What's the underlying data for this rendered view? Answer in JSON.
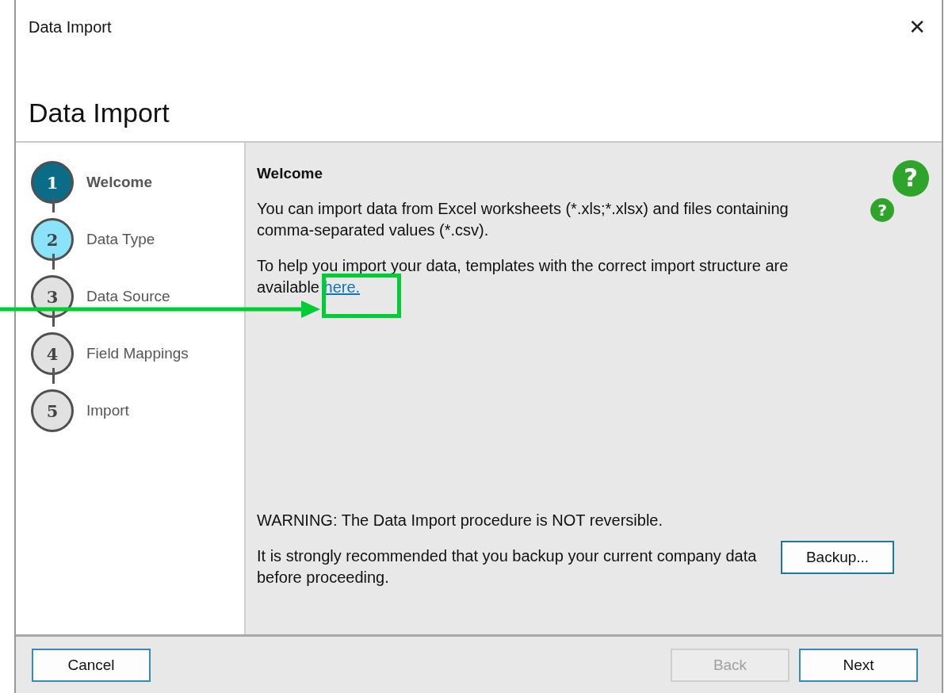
{
  "window": {
    "title": "Data Import",
    "close": "✕"
  },
  "header": {
    "title": "Data Import"
  },
  "steps": [
    {
      "number": "1",
      "label": "Welcome",
      "kind": "current"
    },
    {
      "number": "2",
      "label": "Data Type",
      "kind": "next"
    },
    {
      "number": "3",
      "label": "Data Source",
      "kind": "pending"
    },
    {
      "number": "4",
      "label": "Field Mappings",
      "kind": "pending"
    },
    {
      "number": "5",
      "label": "Import",
      "kind": "pending"
    }
  ],
  "content": {
    "heading": "Welcome",
    "intro": "You can import data from Excel worksheets (*.xls;*.xlsx) and files containing comma-separated values (*.csv).",
    "templates_text": "To help you import your data, templates with the correct import structure are available",
    "templates_link": "here.",
    "warning": "WARNING: The Data Import procedure is NOT reversible.",
    "recommendation": "It is strongly recommended that you backup your current company data before proceeding.",
    "backup_button": "Backup..."
  },
  "help_icons": [
    {
      "glyph": "?"
    },
    {
      "glyph": "?"
    }
  ],
  "annotation": {
    "arrow": true,
    "highlight": true
  },
  "buttons": [
    {
      "label": "Cancel",
      "disabled": false
    },
    {
      "label": "Back",
      "disabled": true
    },
    {
      "label": "Next",
      "disabled": false
    }
  ]
}
